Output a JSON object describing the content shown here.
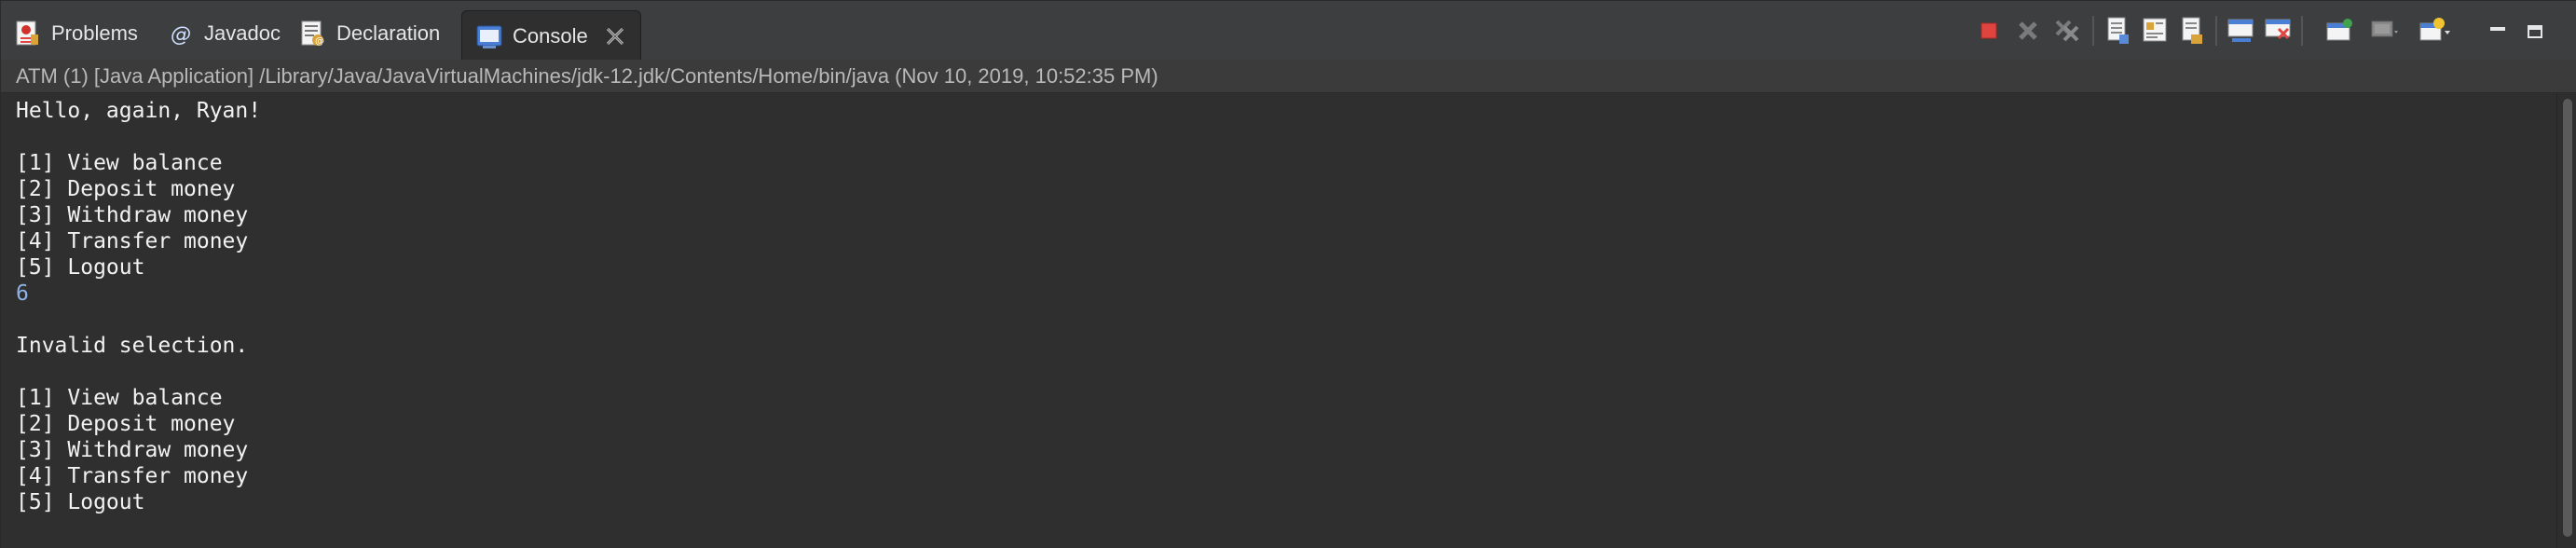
{
  "tabs": [
    {
      "label": "Problems",
      "icon": "problems-icon"
    },
    {
      "label": "Javadoc",
      "icon": "javadoc-icon"
    },
    {
      "label": "Declaration",
      "icon": "declaration-icon"
    },
    {
      "label": "Console",
      "icon": "console-icon",
      "active": true
    }
  ],
  "toolbar": {
    "icons": [
      "terminate-icon",
      "remove-launch-icon",
      "remove-all-terminated-icon",
      "scroll-lock-icon",
      "word-wrap-icon",
      "show-on-stdout-icon",
      "show-on-stderr-icon",
      "pin-console-icon",
      "display-selected-console-icon",
      "open-console-icon",
      "minimize-icon",
      "maximize-icon"
    ]
  },
  "console": {
    "title": "ATM (1) [Java Application] /Library/Java/JavaVirtualMachines/jdk-12.jdk/Contents/Home/bin/java (Nov 10, 2019, 10:52:35 PM)",
    "lines": [
      {
        "text": "Hello, again, Ryan!",
        "kind": "out"
      },
      {
        "text": "",
        "kind": "out"
      },
      {
        "text": "[1] View balance",
        "kind": "out"
      },
      {
        "text": "[2] Deposit money",
        "kind": "out"
      },
      {
        "text": "[3] Withdraw money",
        "kind": "out"
      },
      {
        "text": "[4] Transfer money",
        "kind": "out"
      },
      {
        "text": "[5] Logout",
        "kind": "out"
      },
      {
        "text": "6",
        "kind": "in"
      },
      {
        "text": "",
        "kind": "out"
      },
      {
        "text": "Invalid selection.",
        "kind": "out"
      },
      {
        "text": "",
        "kind": "out"
      },
      {
        "text": "[1] View balance",
        "kind": "out"
      },
      {
        "text": "[2] Deposit money",
        "kind": "out"
      },
      {
        "text": "[3] Withdraw money",
        "kind": "out"
      },
      {
        "text": "[4] Transfer money",
        "kind": "out"
      },
      {
        "text": "[5] Logout",
        "kind": "out"
      }
    ]
  },
  "colors": {
    "console_bg": "#2f2f2f",
    "stdout": "#f2f2f2",
    "stdin": "#8fb3e6",
    "terminate": "#e0443e"
  }
}
